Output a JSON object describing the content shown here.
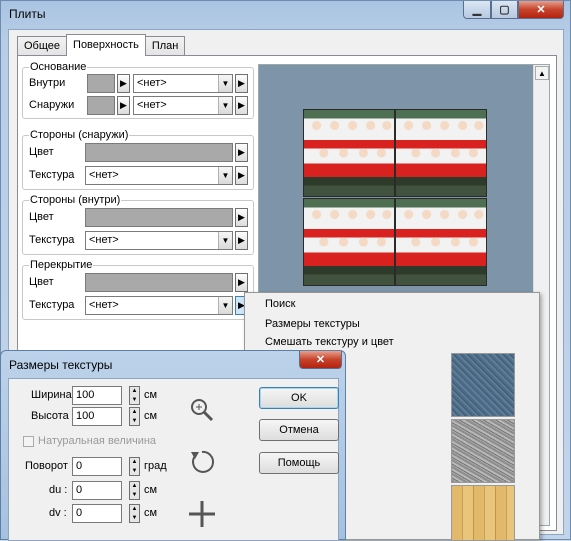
{
  "window": {
    "title": "Плиты",
    "min": "▁",
    "max": "▢",
    "close": "✕"
  },
  "tabs": [
    {
      "label": "Общее"
    },
    {
      "label": "Поверхность"
    },
    {
      "label": "План"
    }
  ],
  "groups": {
    "base": {
      "legend": "Основание",
      "inside_label": "Внутри",
      "inside_select": "<нет>",
      "outside_label": "Снаружи",
      "outside_select": "<нет>"
    },
    "sides_outside": {
      "legend": "Стороны (снаружи)",
      "color_label": "Цвет",
      "texture_label": "Текстура",
      "texture_select": "<нет>"
    },
    "sides_inside": {
      "legend": "Стороны (внутри)",
      "color_label": "Цвет",
      "texture_label": "Текстура",
      "texture_select": "<нет>"
    },
    "overlap": {
      "legend": "Перекрытие",
      "color_label": "Цвет",
      "texture_label": "Текстура",
      "texture_select": "<нет>"
    }
  },
  "context_menu": {
    "items": [
      "Поиск",
      "Размеры текстуры",
      "Смешать текстуру и цвет"
    ]
  },
  "dialog": {
    "title": "Размеры текстуры",
    "close": "✕",
    "width_label": "Ширина",
    "width_value": "100",
    "height_label": "Высота",
    "height_value": "100",
    "natural_size_label": "Натуральная величина",
    "rotation_label": "Поворот",
    "rotation_value": "0",
    "du_label": "du :",
    "du_value": "0",
    "dv_label": "dv :",
    "dv_value": "0",
    "unit_cm": "см",
    "unit_deg": "град",
    "ok_label": "ОK",
    "cancel_label": "Отмена",
    "help_label": "Помощь"
  },
  "colors": {
    "swatch_gray": "#a9a9a9",
    "preview_bg": "#7e95a9",
    "title_bg": "#b7cde6"
  }
}
